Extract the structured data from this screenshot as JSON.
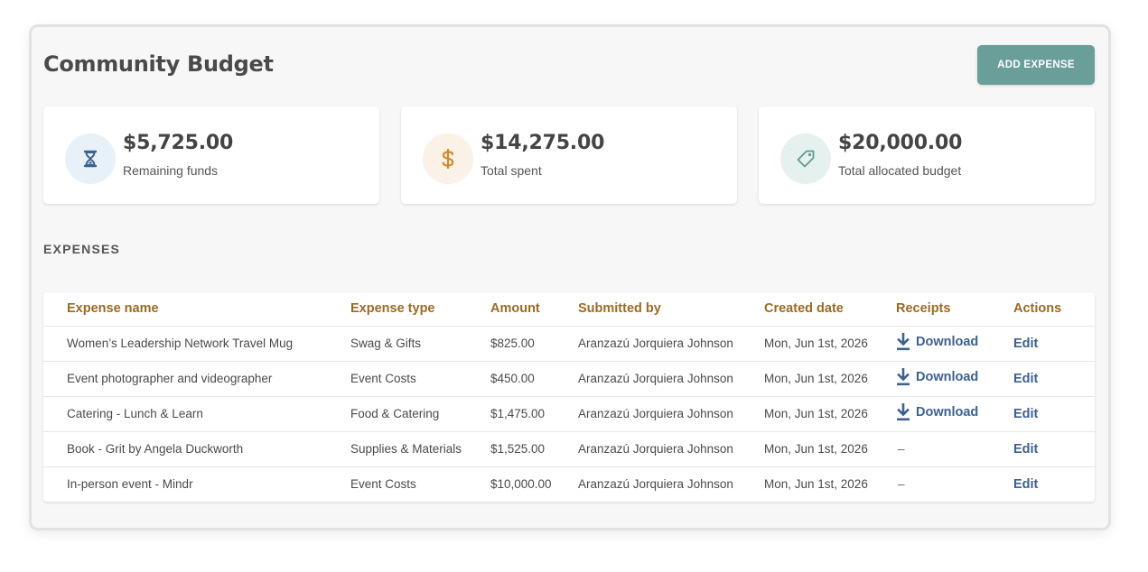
{
  "header": {
    "title": "Community Budget",
    "add_button_label": "ADD EXPENSE"
  },
  "cards": [
    {
      "value": "$5,725.00",
      "label": "Remaining funds",
      "icon": "hourglass-icon",
      "color": "#3d6190",
      "bg": "#e8f0f8"
    },
    {
      "value": "$14,275.00",
      "label": "Total spent",
      "icon": "dollar-icon",
      "color": "#d08a2e",
      "bg": "#fbf1e6"
    },
    {
      "value": "$20,000.00",
      "label": "Total allocated budget",
      "icon": "tag-icon",
      "color": "#5e9a92",
      "bg": "#e6f1ef"
    }
  ],
  "expenses": {
    "section_title": "EXPENSES",
    "columns": [
      "Expense name",
      "Expense type",
      "Amount",
      "Submitted by",
      "Created date",
      "Receipts",
      "Actions"
    ],
    "download_label": "Download",
    "edit_label": "Edit",
    "no_receipt": "–",
    "rows": [
      {
        "name": "Women’s Leadership Network Travel Mug",
        "type": "Swag & Gifts",
        "amount": "$825.00",
        "submitted_by": "Aranzazú Jorquiera Johnson",
        "date": "Mon, Jun 1st, 2026",
        "has_receipt": true
      },
      {
        "name": "Event photographer and videographer",
        "type": "Event Costs",
        "amount": "$450.00",
        "submitted_by": "Aranzazú Jorquiera Johnson",
        "date": "Mon, Jun 1st, 2026",
        "has_receipt": true
      },
      {
        "name": "Catering - Lunch & Learn",
        "type": "Food & Catering",
        "amount": "$1,475.00",
        "submitted_by": "Aranzazú Jorquiera Johnson",
        "date": "Mon, Jun 1st, 2026",
        "has_receipt": true
      },
      {
        "name": "Book - Grit by Angela Duckworth",
        "type": "Supplies & Materials",
        "amount": "$1,525.00",
        "submitted_by": "Aranzazú Jorquiera Johnson",
        "date": "Mon, Jun 1st, 2026",
        "has_receipt": false
      },
      {
        "name": "In-person event - Mindr",
        "type": "Event Costs",
        "amount": "$10,000.00",
        "submitted_by": "Aranzazú Jorquiera Johnson",
        "date": "Mon, Jun 1st, 2026",
        "has_receipt": false
      }
    ]
  },
  "colors": {
    "accent_button": "#6a9e99",
    "link": "#3d6190",
    "table_header": "#9c6a24"
  }
}
